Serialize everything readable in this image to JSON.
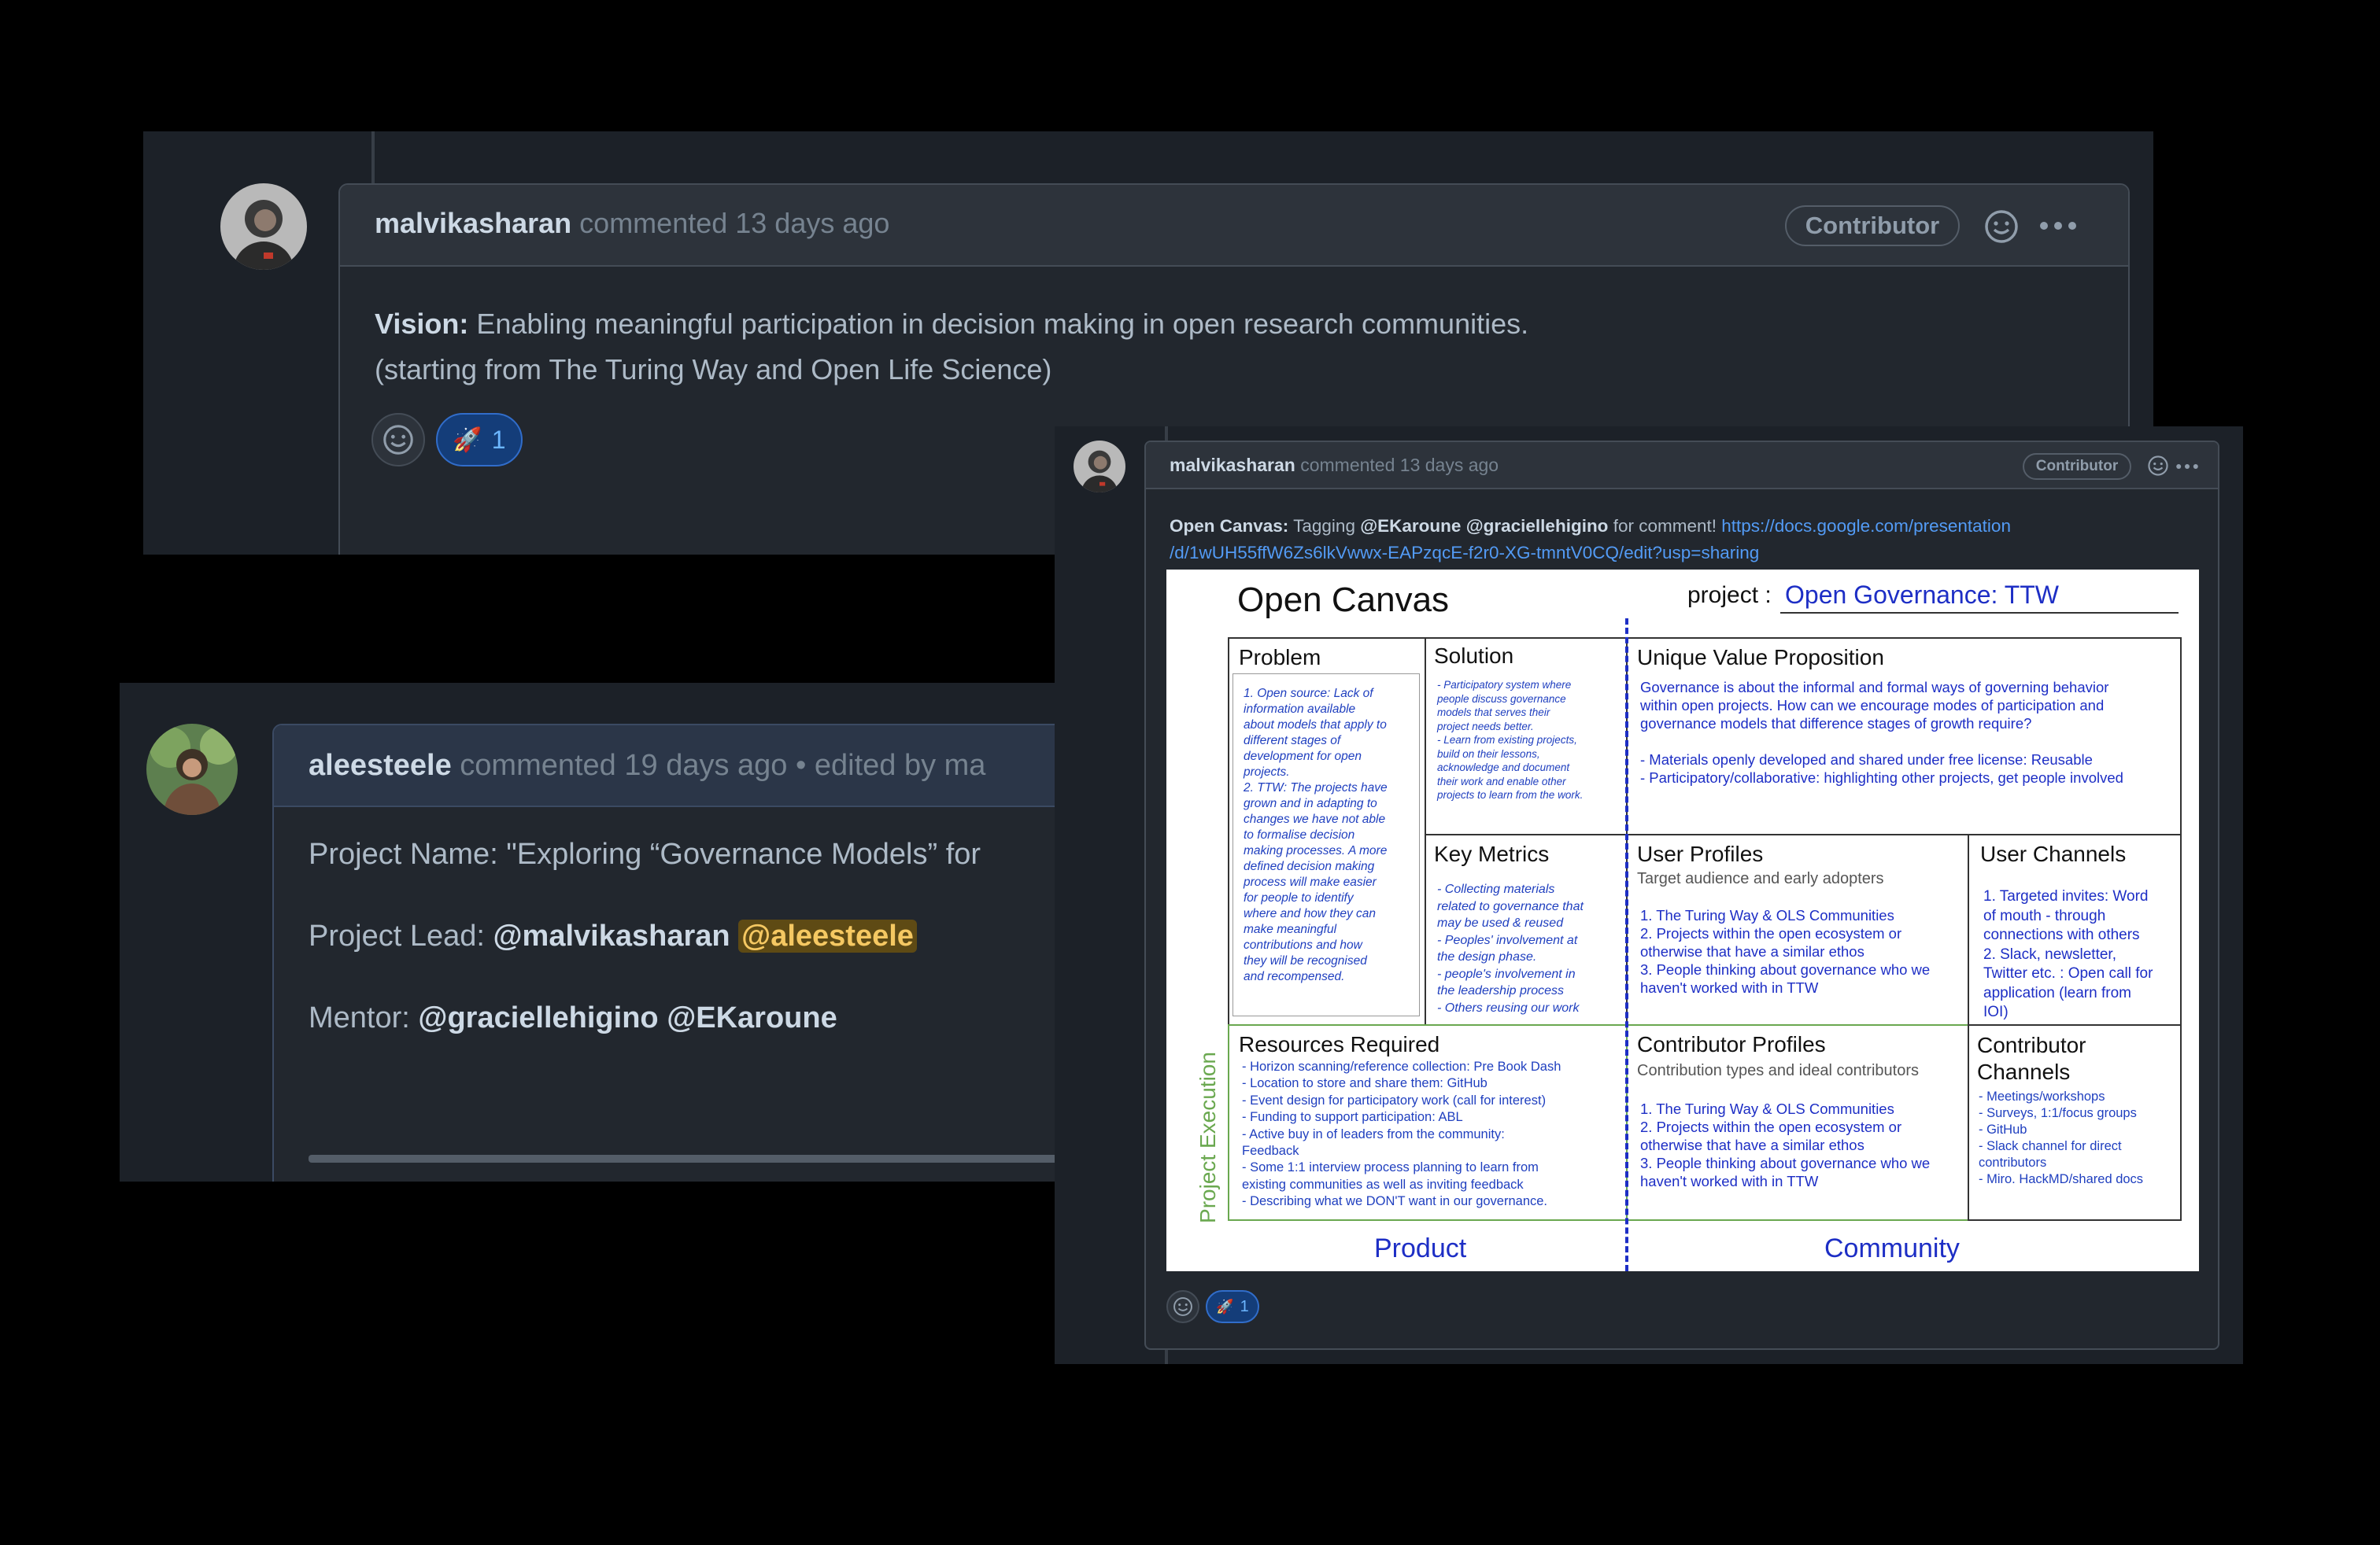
{
  "comment1": {
    "author": "malvikasharan",
    "meta": "commented 13 days ago",
    "badge": "Contributor",
    "vision_label": "Vision:",
    "vision_text": " Enabling meaningful participation in decision making in open research communities.",
    "vision_line2": "(starting from The Turing Way and Open Life Science)",
    "reaction_count": "1"
  },
  "comment2": {
    "author": "aleesteele",
    "meta": "commented 19 days ago",
    "edited": "• edited by ma",
    "project_name": "Project Name: \"Exploring “Governance Models” for",
    "lead_label": "Project Lead:",
    "lead_1": "@malvikasharan",
    "lead_2": "@aleesteele",
    "mentor_label": "Mentor:",
    "mentor_1": "@graciellehigino",
    "mentor_2": "@EKaroune"
  },
  "comment3": {
    "author": "malvikasharan",
    "meta": "commented 13 days ago",
    "badge": "Contributor",
    "label": "Open Canvas:",
    "text_a": " Tagging ",
    "mention_1": "@EKaroune",
    "mention_2": "@graciellehigino",
    "text_b": " for comment! ",
    "link_1": "https://docs.google.com/presentation",
    "link_2": "/d/1wUH55ffW6Zs6lkVwwx-EAPzqcE-f2r0-XG-tmntV0CQ/edit?usp=sharing",
    "reaction_count": "1"
  },
  "canvas": {
    "title": "Open Canvas",
    "project_label": "project :",
    "project_value": "Open Governance: TTW",
    "problem": {
      "heading": "Problem",
      "text": "1. Open source: Lack of\ninformation available\nabout models that apply to\ndifferent stages of\ndevelopment for open\nprojects.\n2. TTW: The projects have\ngrown and in adapting to\nchanges we have not able\nto formalise decision\nmaking processes. A more\ndefined decision making\nprocess will make easier\nfor people to identify\nwhere and how they can\nmake meaningful\ncontributions and how\nthey will be recognised\nand recompensed."
    },
    "solution": {
      "heading": "Solution",
      "text": "- Participatory system where\npeople discuss governance\nmodels that serves their\nproject needs better.\n- Learn from existing projects,\nbuild on their lessons,\nacknowledge and document\ntheir work and enable other\nprojects to learn from the work."
    },
    "uvp": {
      "heading": "Unique Value Proposition",
      "text": "Governance is about the informal and formal ways of governing behavior\nwithin open projects. How can we encourage modes of participation and\ngovernance models that difference stages of growth require?\n\n- Materials openly developed and shared under free license: Reusable\n- Participatory/collaborative:  highlighting other projects, get people involved"
    },
    "key_metrics": {
      "heading": "Key Metrics",
      "text": "- Collecting materials\nrelated to governance that\nmay be used & reused\n- Peoples' involvement at\nthe design phase.\n- people's involvement in\nthe  leadership process\n- Others reusing our work"
    },
    "user_profiles": {
      "heading": "User Profiles",
      "sub": "Target audience and early adopters",
      "text": "1. The Turing Way & OLS Communities\n2. Projects within the open ecosystem or\notherwise that have a similar ethos\n3. People thinking about governance who we\nhaven't worked with in TTW"
    },
    "user_channels": {
      "heading": "User Channels",
      "text": "1. Targeted invites: Word\nof mouth - through\nconnections with others\n2. Slack, newsletter,\nTwitter etc. : Open call for\napplication (learn from\nIOI)"
    },
    "resources": {
      "heading": "Resources Required",
      "text": "- Horizon scanning/reference collection: Pre Book Dash\n- Location to store and share them: GitHub\n- Event design for participatory work (call for interest)\n- Funding to support participation: ABL\n- Active buy in of leaders from the community:\nFeedback\n- Some 1:1 interview process planning to learn from\nexisting communities as well as inviting feedback\n- Describing what we DON'T want in our governance."
    },
    "contributor_profiles": {
      "heading": "Contributor Profiles",
      "sub": "Contribution types and ideal contributors",
      "text": "1. The Turing Way & OLS Communities\n2. Projects within the open ecosystem or\notherwise that have a similar ethos\n3. People thinking about governance who we\nhaven't worked with in TTW"
    },
    "contributor_channels": {
      "heading": "Contributor\nChannels",
      "text": "- Meetings/workshops\n- Surveys, 1:1/focus groups\n- GitHub\n- Slack channel for direct\ncontributors\n- Miro. HackMD/shared docs"
    },
    "side_label": "Project Execution",
    "bottom_left": "Product",
    "bottom_right": "Community",
    "colors": {
      "blue": "#1d2ec5",
      "green": "#6aa84f"
    }
  }
}
